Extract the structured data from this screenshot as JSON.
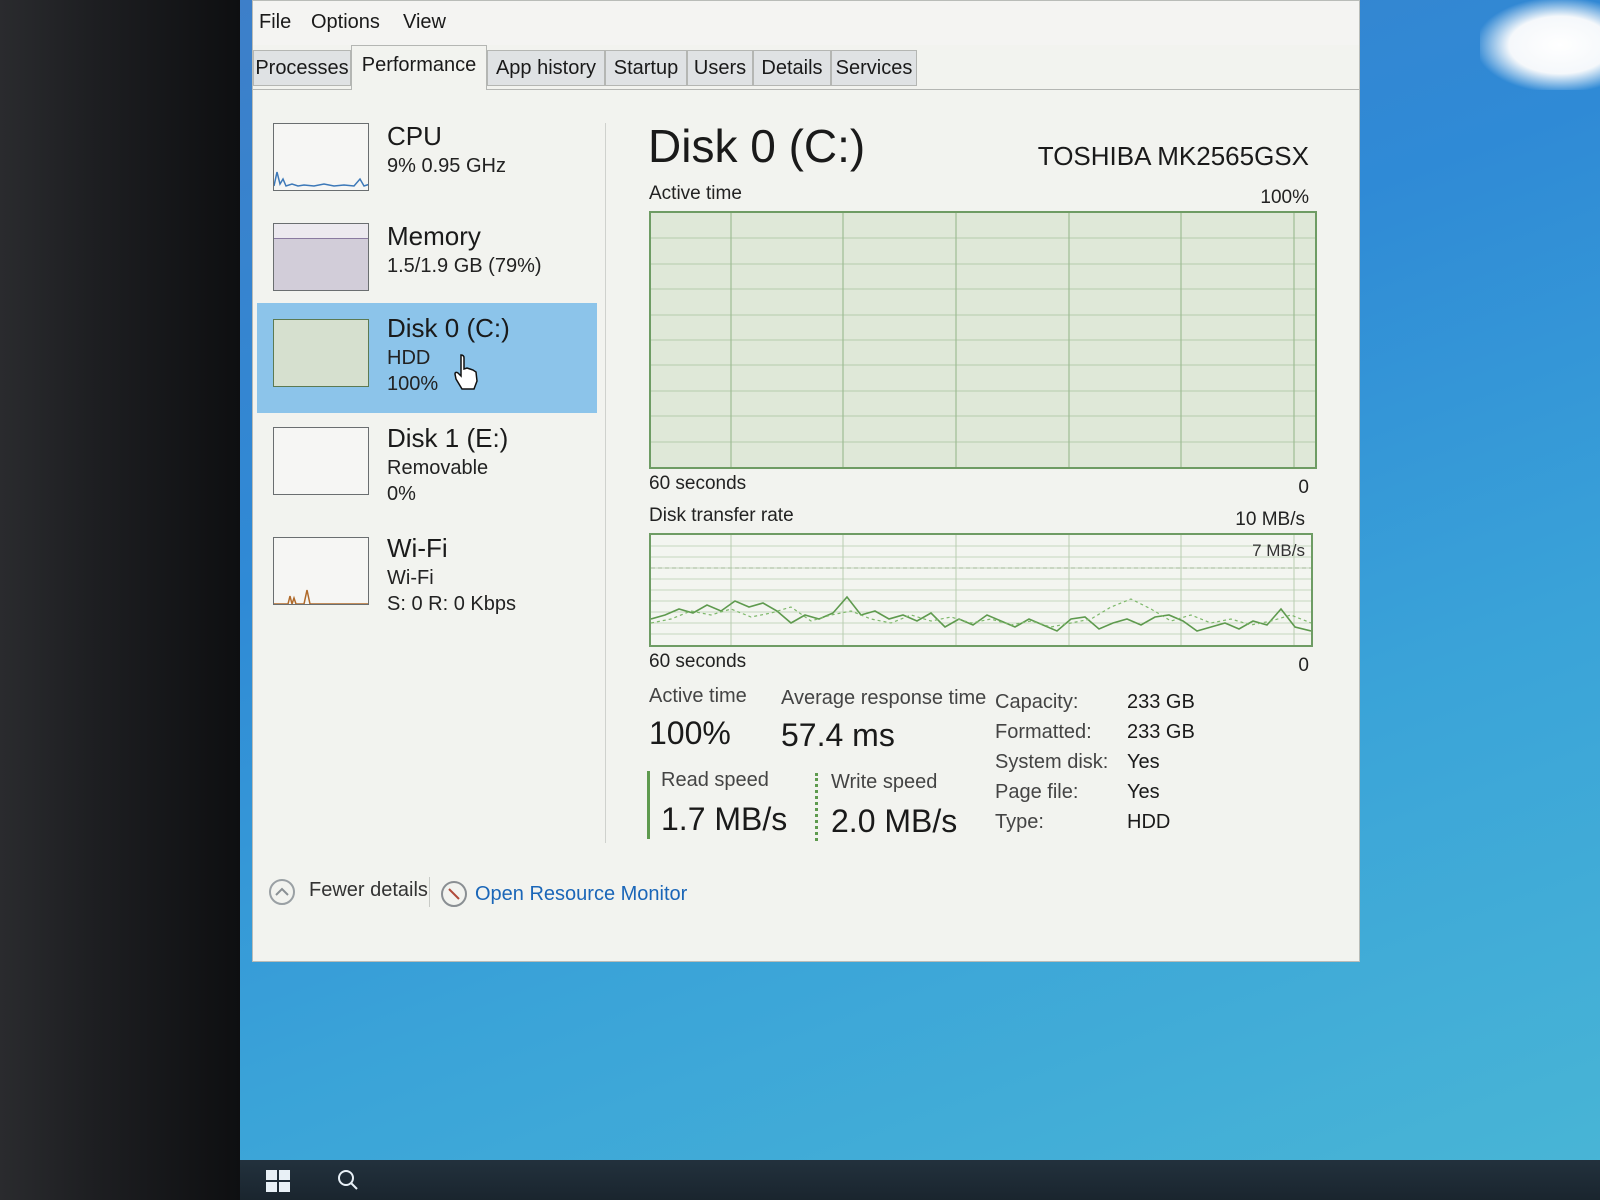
{
  "menu": [
    "File",
    "Options",
    "View"
  ],
  "tabs": [
    {
      "label": "Processes",
      "active": false
    },
    {
      "label": "Performance",
      "active": true
    },
    {
      "label": "App history",
      "active": false
    },
    {
      "label": "Startup",
      "active": false
    },
    {
      "label": "Users",
      "active": false
    },
    {
      "label": "Details",
      "active": false
    },
    {
      "label": "Services",
      "active": false
    }
  ],
  "sidebar": [
    {
      "title": "CPU",
      "sub1": "9%  0.95 GHz",
      "sub2": ""
    },
    {
      "title": "Memory",
      "sub1": "1.5/1.9 GB (79%)",
      "sub2": ""
    },
    {
      "title": "Disk 0 (C:)",
      "sub1": "HDD",
      "sub2": "100%"
    },
    {
      "title": "Disk 1 (E:)",
      "sub1": "Removable",
      "sub2": "0%"
    },
    {
      "title": "Wi-Fi",
      "sub1": "Wi-Fi",
      "sub2": "S: 0 R: 0 Kbps"
    }
  ],
  "main": {
    "title": "Disk 0 (C:)",
    "model": "TOSHIBA MK2565GSX",
    "active_graph": {
      "label": "Active time",
      "max": "100%",
      "time": "60 seconds",
      "min": "0"
    },
    "transfer_graph": {
      "label": "Disk transfer rate",
      "max": "10 MB/s",
      "inner": "7 MB/s",
      "time": "60 seconds",
      "min": "0"
    }
  },
  "stats": {
    "active_label": "Active time",
    "active_value": "100%",
    "response_label": "Average response time",
    "response_value": "57.4 ms",
    "read_label": "Read speed",
    "read_value": "1.7 MB/s",
    "write_label": "Write speed",
    "write_value": "2.0 MB/s"
  },
  "details": [
    {
      "key": "Capacity:",
      "value": "233 GB"
    },
    {
      "key": "Formatted:",
      "value": "233 GB"
    },
    {
      "key": "System disk:",
      "value": "Yes"
    },
    {
      "key": "Page file:",
      "value": "Yes"
    },
    {
      "key": "Type:",
      "value": "HDD"
    }
  ],
  "footer": {
    "fewer": "Fewer details",
    "monitor": "Open Resource Monitor"
  },
  "colors": {
    "selected": "#8cc4ea",
    "graph_border": "#6e9c64",
    "link": "#1a66b8"
  }
}
